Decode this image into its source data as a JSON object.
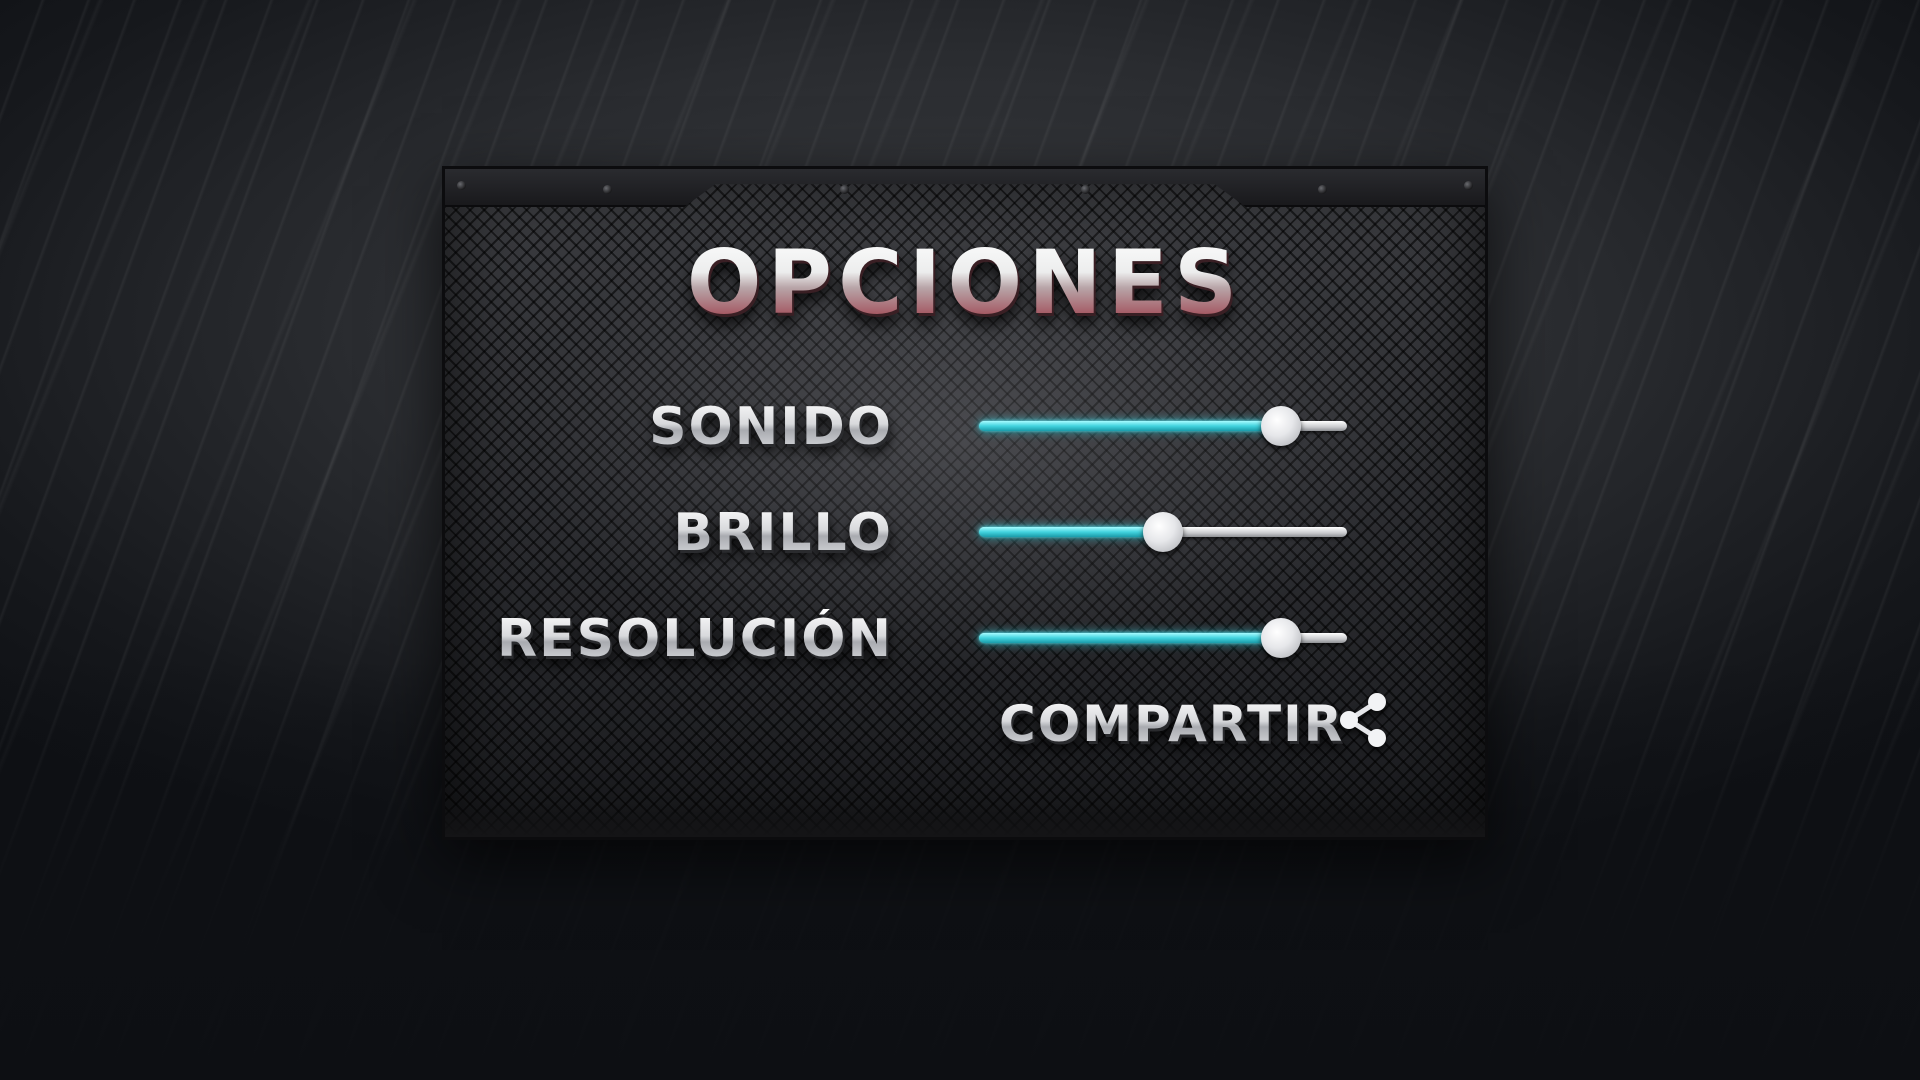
{
  "screen": {
    "title": "OPCIONES"
  },
  "options": [
    {
      "id": "sound",
      "label": "SONIDO",
      "value": 0.82
    },
    {
      "id": "brightness",
      "label": "BRILLO",
      "value": 0.5
    },
    {
      "id": "resolution",
      "label": "RESOLUCIÓN",
      "value": 0.82
    }
  ],
  "share": {
    "label": "COMPARTIR",
    "icon": "share-icon"
  },
  "colors": {
    "slider_fill": "#42d3de",
    "slider_track": "#c9cacd",
    "title_accent": "#a55c66",
    "panel_bg": "#2d2e32"
  }
}
